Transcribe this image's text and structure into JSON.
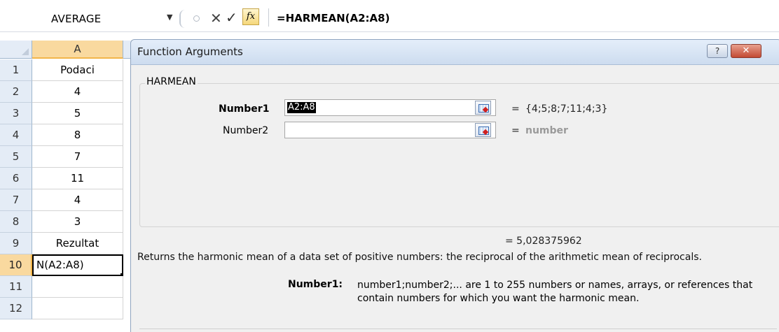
{
  "formula_bar": {
    "name_box": "AVERAGE",
    "cancel_glyph": "✕",
    "enter_glyph": "✓",
    "fx_label": "fx",
    "formula": "=HARMEAN(A2:A8)"
  },
  "sheet": {
    "column_header": "A",
    "rows": [
      {
        "num": "1",
        "value": "Podaci"
      },
      {
        "num": "2",
        "value": "4"
      },
      {
        "num": "3",
        "value": "5"
      },
      {
        "num": "4",
        "value": "8"
      },
      {
        "num": "5",
        "value": "7"
      },
      {
        "num": "6",
        "value": "11"
      },
      {
        "num": "7",
        "value": "4"
      },
      {
        "num": "8",
        "value": "3"
      },
      {
        "num": "9",
        "value": "Rezultat"
      },
      {
        "num": "10",
        "value": "N(A2:A8)"
      },
      {
        "num": "11",
        "value": ""
      },
      {
        "num": "12",
        "value": ""
      }
    ]
  },
  "dialog": {
    "title": "Function Arguments",
    "help_label": "?",
    "close_label": "✕",
    "function_name": "HARMEAN",
    "args": [
      {
        "label": "Number1",
        "input": "A2:A8",
        "equals": "=",
        "value": "{4;5;8;7;11;4;3}"
      },
      {
        "label": "Number2",
        "input": "",
        "equals": "=",
        "value": "number"
      }
    ],
    "result_line": "=  5,028375962",
    "description": "Returns the harmonic mean of a data set of positive numbers: the reciprocal of the arithmetic mean of reciprocals.",
    "arg_desc_name": "Number1:",
    "arg_desc_text": "number1;number2;... are 1 to 255 numbers or names, arrays, or references that contain numbers for which you want the harmonic mean."
  }
}
